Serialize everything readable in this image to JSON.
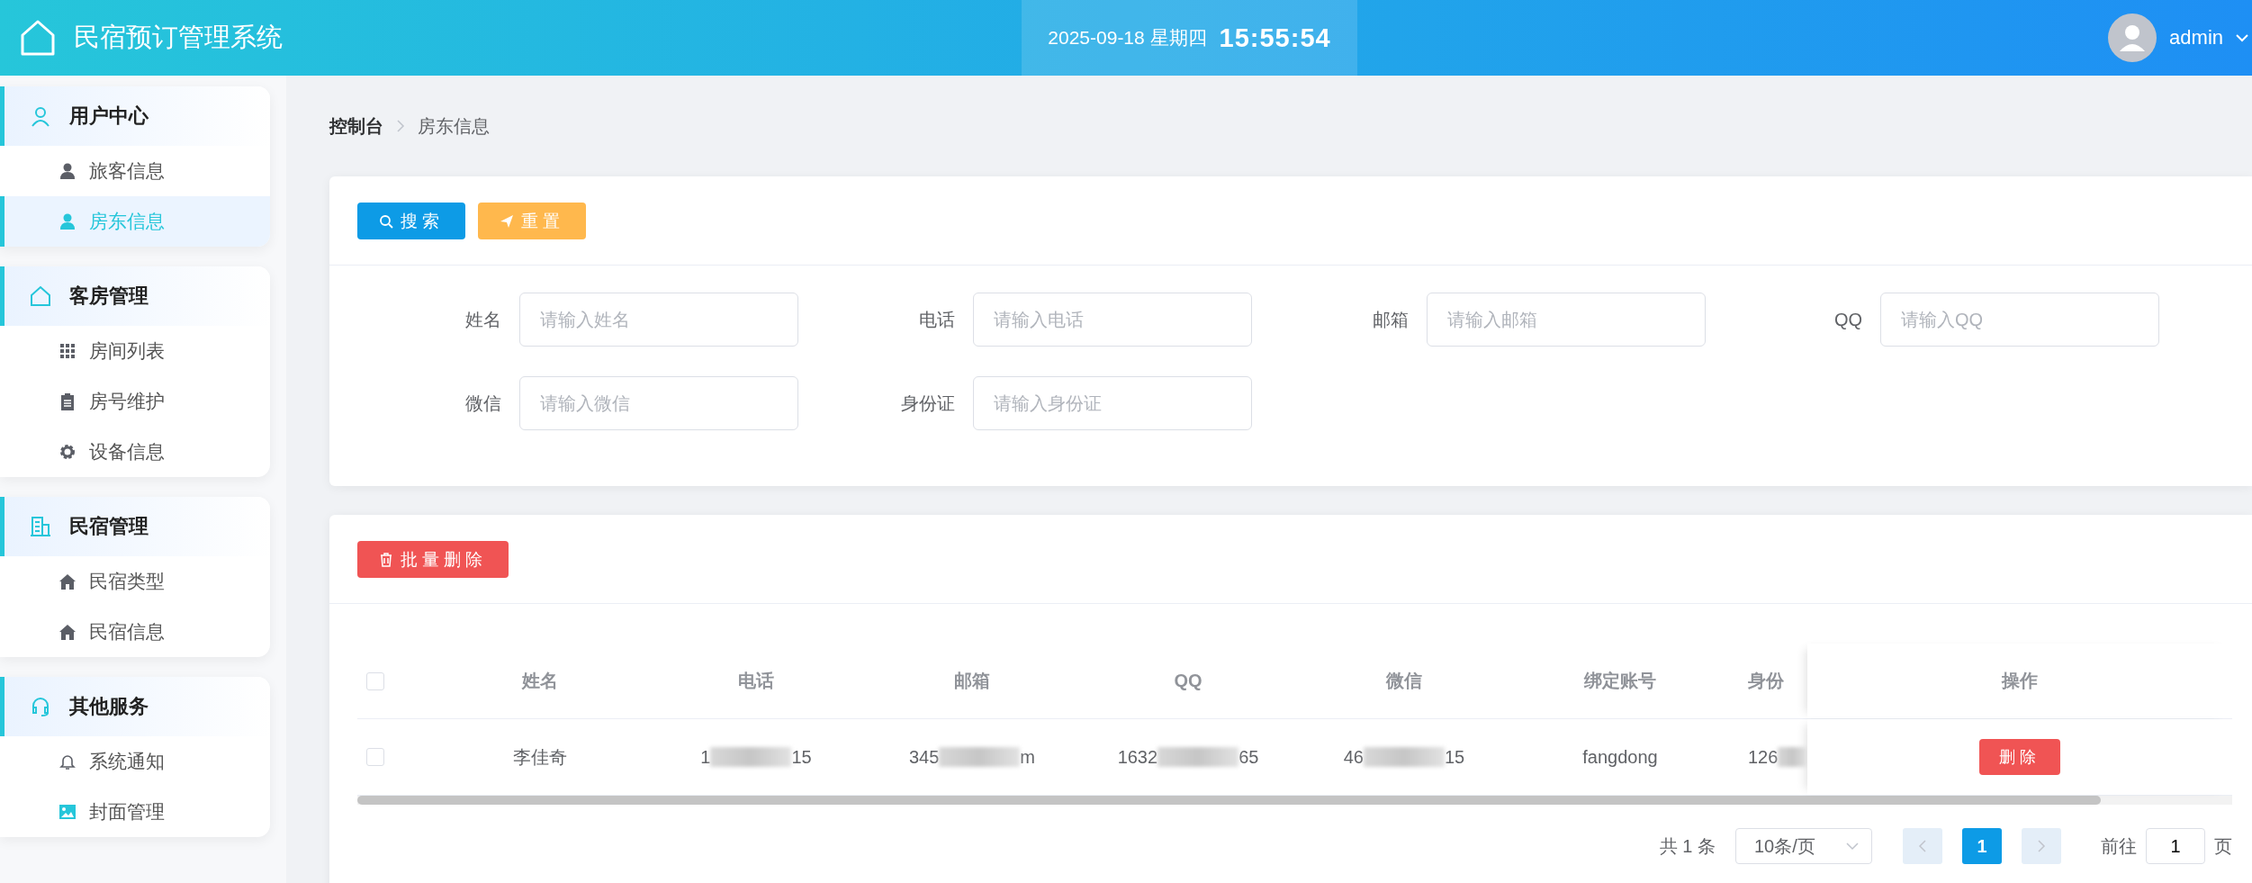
{
  "header": {
    "title": "民宿预订管理系统",
    "date": "2025-09-18",
    "weekday": "星期四",
    "time": "15:55:54",
    "user": "admin"
  },
  "sidebar": {
    "groups": [
      {
        "title": "用户中心",
        "items": [
          {
            "label": "旅客信息",
            "selected": false
          },
          {
            "label": "房东信息",
            "selected": true
          }
        ]
      },
      {
        "title": "客房管理",
        "items": [
          {
            "label": "房间列表",
            "selected": false
          },
          {
            "label": "房号维护",
            "selected": false
          },
          {
            "label": "设备信息",
            "selected": false
          }
        ]
      },
      {
        "title": "民宿管理",
        "items": [
          {
            "label": "民宿类型",
            "selected": false
          },
          {
            "label": "民宿信息",
            "selected": false
          }
        ]
      },
      {
        "title": "其他服务",
        "items": [
          {
            "label": "系统通知",
            "selected": false
          },
          {
            "label": "封面管理",
            "selected": false
          }
        ]
      }
    ]
  },
  "breadcrumb": [
    "控制台",
    "房东信息"
  ],
  "search_buttons": [
    {
      "kind": "search",
      "label": "搜索"
    },
    {
      "kind": "reset",
      "label": "重置"
    }
  ],
  "search_fields": [
    {
      "label": "姓名",
      "placeholder": "请输入姓名"
    },
    {
      "label": "电话",
      "placeholder": "请输入电话"
    },
    {
      "label": "邮箱",
      "placeholder": "请输入邮箱"
    },
    {
      "label": "QQ",
      "placeholder": "请输入QQ"
    },
    {
      "label": "微信",
      "placeholder": "请输入微信"
    },
    {
      "label": "身份证",
      "placeholder": "请输入身份证"
    }
  ],
  "batch_delete": "批量删除",
  "table": {
    "header_checked": false,
    "columns": [
      "姓名",
      "电话",
      "邮箱",
      "QQ",
      "微信",
      "绑定账号",
      "身份"
    ],
    "action_column": "操作",
    "rows": [
      {
        "checked": false,
        "action": "删除",
        "cells": [
          {
            "kind": "text",
            "text": "李佳奇"
          },
          {
            "kind": "redacted",
            "start": "1",
            "end": "15"
          },
          {
            "kind": "redacted",
            "start": "345",
            "end": "m"
          },
          {
            "kind": "redacted",
            "start": "1632",
            "end": "65"
          },
          {
            "kind": "redacted",
            "start": "46",
            "end": "15"
          },
          {
            "kind": "text",
            "text": "fangdong"
          },
          {
            "kind": "redacted",
            "start": "126"
          }
        ]
      }
    ]
  },
  "pagination": {
    "total": "共 1 条",
    "page_size": "10条/页",
    "pages": [
      {
        "label": "1",
        "selected": true
      }
    ],
    "goto_label": "前往",
    "goto_value": "1",
    "suffix": "页"
  }
}
